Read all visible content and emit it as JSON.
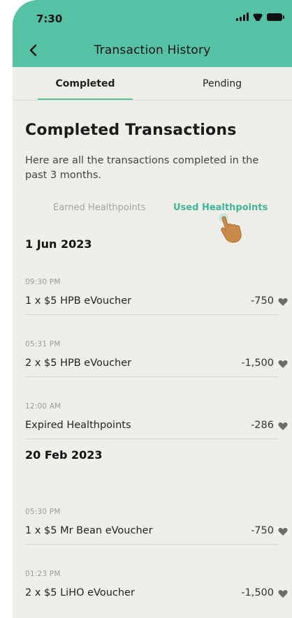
{
  "status": {
    "time": "7:30"
  },
  "header": {
    "title": "Transaction History"
  },
  "tabs": [
    {
      "label": "Completed",
      "active": true
    },
    {
      "label": "Pending",
      "active": false
    }
  ],
  "page": {
    "title": "Completed Transactions",
    "subtitle": "Here are all the transactions completed in the past 3 months."
  },
  "filters": {
    "earned": "Earned Healthpoints",
    "used": "Used Healthpoints",
    "selected": "used"
  },
  "colors": {
    "accent": "#55c2a5",
    "accent_text": "#3fb596",
    "background": "#efeee9"
  },
  "groups": [
    {
      "date": "1 Jun 2023",
      "items": [
        {
          "time": "09:30 PM",
          "title": "1 x $5 HPB eVoucher",
          "points": "-750"
        },
        {
          "time": "05:31 PM",
          "title": "2 x $5 HPB eVoucher",
          "points": "-1,500"
        },
        {
          "time": "12:00 AM",
          "title": "Expired Healthpoints",
          "points": "-286"
        }
      ]
    },
    {
      "date": "20 Feb 2023",
      "items": [
        {
          "time": "05:30 PM",
          "title": "1 x $5 Mr Bean eVoucher",
          "points": "-750"
        },
        {
          "time": "01:23 PM",
          "title": "2 x $5 LiHO eVoucher",
          "points": "-1,500"
        }
      ]
    }
  ],
  "icons": {
    "back": "chevron-left-icon",
    "points": "heart-icon",
    "pointer": "hand-pointer-icon"
  }
}
